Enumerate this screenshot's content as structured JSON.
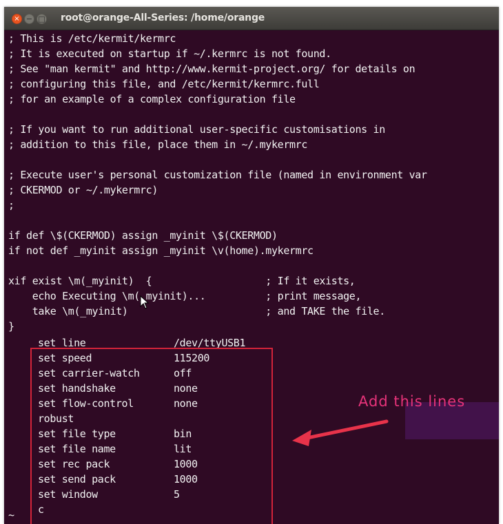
{
  "window": {
    "title": "root@orange-All-Series: /home/orange"
  },
  "colors": {
    "terminal_bg": "#2f0a24",
    "text": "#f2f2f2",
    "close_button": "#e95420",
    "highlight_box": "#d3243a",
    "annotation": "#e8337a"
  },
  "terminal": {
    "lines": [
      "; This is /etc/kermit/kermrc",
      "; It is executed on startup if ~/.kermrc is not found.",
      "; See \"man kermit\" and http://www.kermit-project.org/ for details on",
      "; configuring this file, and /etc/kermit/kermrc.full",
      "; for an example of a complex configuration file",
      "",
      "; If you want to run additional user-specific customisations in",
      "; addition to this file, place them in ~/.mykermrc",
      "",
      "; Execute user's personal customization file (named in environment var",
      "; CKERMOD or ~/.mykermrc)",
      ";",
      "",
      "if def \\$(CKERMOD) assign _myinit \\$(CKERMOD)",
      "if not def _myinit assign _myinit \\v(home).mykermrc",
      "",
      "xif exist \\m(_myinit)  {                   ; If it exists,",
      "    echo Executing \\m(_myinit)...          ; print message,",
      "    take \\m(_myinit)                       ; and TAKE the file.",
      "}"
    ],
    "settings": [
      {
        "key": "set line",
        "value": "/dev/ttyUSB1"
      },
      {
        "key": "set speed",
        "value": "115200"
      },
      {
        "key": "set carrier-watch",
        "value": "off"
      },
      {
        "key": "set handshake",
        "value": "none"
      },
      {
        "key": "set flow-control",
        "value": "none"
      },
      {
        "key": "robust",
        "value": ""
      },
      {
        "key": "set file type",
        "value": "bin"
      },
      {
        "key": "set file name",
        "value": "lit"
      },
      {
        "key": "set rec pack",
        "value": "1000"
      },
      {
        "key": "set send pack",
        "value": "1000"
      },
      {
        "key": "set window",
        "value": "5"
      },
      {
        "key": "c",
        "value": ""
      }
    ],
    "tilde": "~"
  },
  "annotation": {
    "text": "Add this lines"
  },
  "icons": {
    "close": "close-icon",
    "minimize": "minimize-icon",
    "maximize": "maximize-icon",
    "cursor": "mouse-cursor-icon",
    "arrow": "annotation-arrow"
  }
}
